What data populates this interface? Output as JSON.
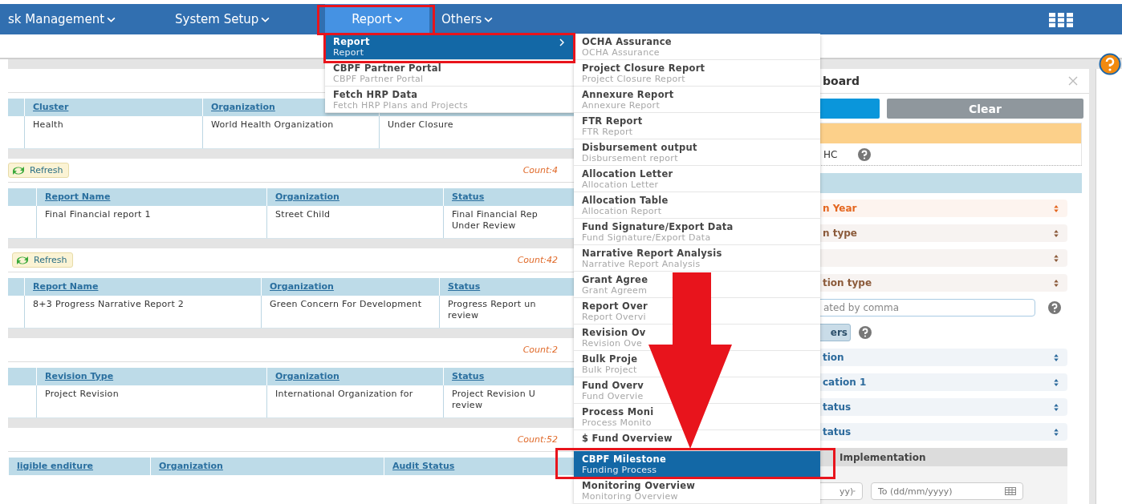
{
  "nav": {
    "items": [
      {
        "label": "sk Management",
        "selected": false
      },
      {
        "label": "System Setup",
        "selected": false
      },
      {
        "label": "Report",
        "selected": true
      },
      {
        "label": "Others",
        "selected": false
      }
    ]
  },
  "report_menu": {
    "items": [
      {
        "title": "Report",
        "subtitle": "Report",
        "selected": true,
        "has_submenu": true
      },
      {
        "title": "CBPF Partner Portal",
        "subtitle": "CBPF Partner Portal",
        "selected": false,
        "has_submenu": false
      },
      {
        "title": "Fetch HRP Data",
        "subtitle": "Fetch HRP Plans and Projects",
        "selected": false,
        "has_submenu": false
      }
    ]
  },
  "submenu": {
    "items": [
      {
        "title": "OCHA Assurance",
        "subtitle": "OCHA Assurance",
        "selected": false
      },
      {
        "title": "Project Closure Report",
        "subtitle": "Project Closure Report",
        "selected": false
      },
      {
        "title": "Annexure Report",
        "subtitle": "Annexure Report",
        "selected": false
      },
      {
        "title": "FTR Report",
        "subtitle": "FTR Report",
        "selected": false
      },
      {
        "title": "Disbursement output",
        "subtitle": "Disbursement report",
        "selected": false
      },
      {
        "title": "Allocation Letter",
        "subtitle": "Allocation Letter",
        "selected": false
      },
      {
        "title": "Allocation Table",
        "subtitle": "Allocation Report",
        "selected": false
      },
      {
        "title": "Fund Signature/Export Data",
        "subtitle": "Fund Signature/Export Data",
        "selected": false
      },
      {
        "title": "Narrative Report Analysis",
        "subtitle": "Narrative Report Analysis",
        "selected": false
      },
      {
        "title": "Grant Agree",
        "subtitle": "Grant Agreem",
        "selected": false
      },
      {
        "title": "Report Over",
        "subtitle": "Report Overvi",
        "selected": false
      },
      {
        "title": "Revision Ov",
        "subtitle": "Revision Ove",
        "selected": false
      },
      {
        "title": "Bulk Proje",
        "subtitle": "Bulk Project",
        "selected": false
      },
      {
        "title": "Fund Overv",
        "subtitle": "Fund Overvie",
        "selected": false
      },
      {
        "title": "Process Moni",
        "subtitle": "Process Monito",
        "selected": false
      },
      {
        "title": "$ Fund Overview",
        "selected": false
      },
      {
        "title": "CBPF Milestone",
        "subtitle": "Funding Process",
        "selected": true
      },
      {
        "title": "Monitoring Overview",
        "subtitle": "Monitoring Overview",
        "selected": false
      }
    ]
  },
  "sections": [
    {
      "columns": [
        "Cluster",
        "Organization"
      ],
      "rows": [
        [
          "Health",
          "World Health Organization",
          "Under Closure"
        ]
      ]
    },
    {
      "toolbar": {
        "refresh": "Refresh",
        "count": "Count:4"
      },
      "columns": [
        "Report Name",
        "Organization",
        "Status"
      ],
      "rows": [
        [
          "Final Financial report 1",
          "Street Child",
          "Final Financial Rep Under Review"
        ]
      ]
    },
    {
      "toolbar": {
        "refresh": "Refresh",
        "count": "Count:42"
      },
      "columns": [
        "Report Name",
        "Organization",
        "Status"
      ],
      "rows": [
        [
          "8+3 Progress Narrative Report 2",
          "Green Concern For Development",
          "Progress Report un review"
        ]
      ]
    },
    {
      "toolbar": {
        "count": "Count:2"
      },
      "columns": [
        "Revision Type",
        "Organization",
        "Status"
      ],
      "rows": [
        [
          "Project Revision",
          "International Organization for",
          "Project Revision U review"
        ]
      ]
    },
    {
      "toolbar": {
        "count": "Count:52"
      },
      "columns": [
        "ligible enditure",
        "Organization",
        "Audit Status"
      ]
    }
  ],
  "filter_panel": {
    "title": "board",
    "clear_button": "Clear",
    "notice": "HC",
    "fields": [
      {
        "kind": "select",
        "label": "n Year",
        "color": "#e4661f"
      },
      {
        "kind": "select",
        "label": "n type",
        "color": "#8b5a3a"
      },
      {
        "kind": "select",
        "color": "#8b5a3a"
      },
      {
        "kind": "select",
        "label": "tion type",
        "color": "#8b5a3a"
      },
      {
        "kind": "text",
        "placeholder": "ated by comma"
      },
      {
        "kind": "button",
        "label": "ers"
      },
      {
        "kind": "select",
        "label": "tion",
        "color": "#2c6a9c"
      },
      {
        "kind": "select",
        "label": "cation 1",
        "color": "#2c6a9c"
      },
      {
        "kind": "select",
        "label": "tatus",
        "color": "#2c6a9c"
      },
      {
        "kind": "select",
        "label": "tatus",
        "color": "#2c6a9c"
      }
    ],
    "implementation": {
      "title": "Implementation",
      "from_placeholder": "yy)",
      "to_placeholder": "To (dd/mm/yyyy)"
    }
  }
}
